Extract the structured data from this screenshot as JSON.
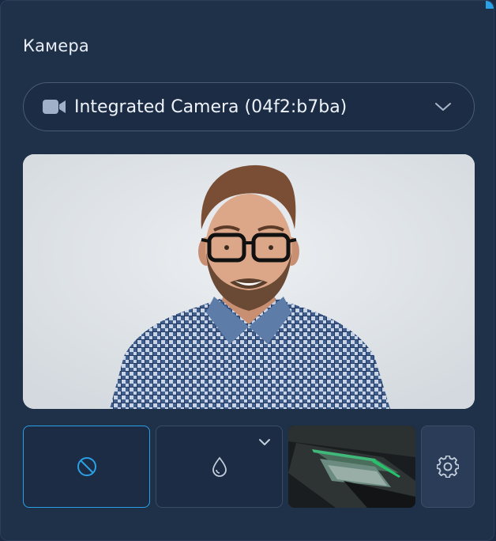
{
  "panel": {
    "title": "Камера"
  },
  "camera_select": {
    "icon": "video-camera-icon",
    "selected_value": "Integrated Camera (04f2:b7ba)",
    "open_icon": "chevron-down-icon"
  },
  "preview": {
    "content": "camera-feed-image"
  },
  "effects": {
    "items": [
      {
        "id": "none",
        "icon": "no-effect-icon",
        "selected": true
      },
      {
        "id": "blur",
        "icon": "blur-droplet-icon",
        "has_dropdown": true
      },
      {
        "id": "background",
        "icon": "background-image-thumbnail"
      },
      {
        "id": "settings",
        "icon": "gear-icon"
      }
    ]
  },
  "colors": {
    "panel_bg": "#1f3049",
    "accent": "#2aa0e6",
    "text": "#eef3fa"
  }
}
